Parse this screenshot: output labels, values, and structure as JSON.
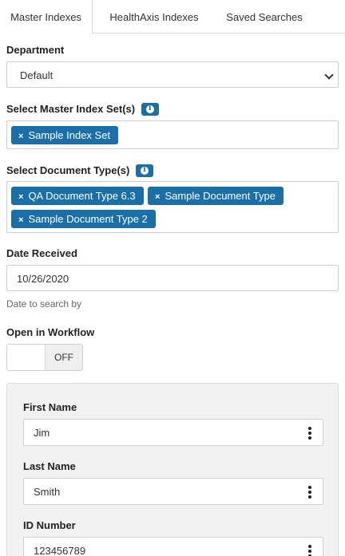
{
  "tabs": [
    {
      "label": "Master Indexes"
    },
    {
      "label": "HealthAxis Indexes"
    },
    {
      "label": "Saved Searches"
    }
  ],
  "department": {
    "label": "Department",
    "value": "Default"
  },
  "master_index_sets": {
    "label": "Select Master Index Set(s)",
    "chips": [
      "Sample Index Set"
    ]
  },
  "document_types": {
    "label": "Select Document Type(s)",
    "chips": [
      "QA Document Type 6.3",
      "Sample Document Type",
      "Sample Document Type 2"
    ]
  },
  "date_received": {
    "label": "Date Received",
    "value": "10/26/2020",
    "help": "Date to search by"
  },
  "open_in_workflow": {
    "label": "Open in Workflow",
    "state": "OFF"
  },
  "fields": [
    {
      "label": "First Name",
      "value": "Jim"
    },
    {
      "label": "Last Name",
      "value": "Smith"
    },
    {
      "label": "ID Number",
      "value": "123456789"
    }
  ],
  "chip_remove_glyph": "×",
  "colors": {
    "chip": "#1b6fa8",
    "panel": "#f2f2f2"
  }
}
